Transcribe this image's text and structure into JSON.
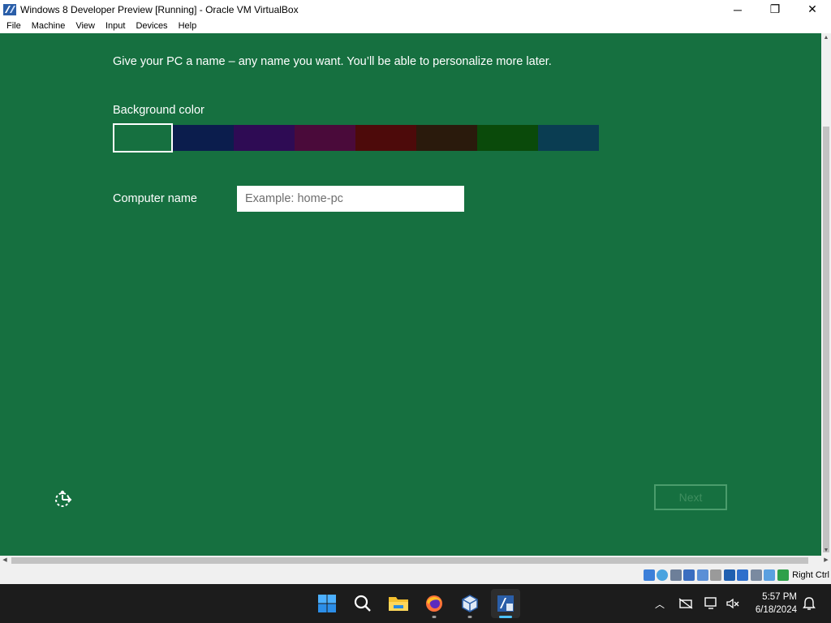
{
  "window": {
    "title": "Windows 8 Developer Preview [Running] - Oracle VM VirtualBox",
    "controls": {
      "minimize": "─",
      "restore": "❐",
      "close": "✕"
    }
  },
  "menu": [
    "File",
    "Machine",
    "View",
    "Input",
    "Devices",
    "Help"
  ],
  "setup": {
    "prompt": "Give your PC a name – any name you want. You’ll be able to personalize more later.",
    "background_label": "Background color",
    "swatches": [
      "#167040",
      "#0b1d4d",
      "#2e0b54",
      "#4a0a3a",
      "#4d0a0a",
      "#2a1a0c",
      "#0a4a0a",
      "#0a3d52"
    ],
    "selected_swatch": 0,
    "computer_name_label": "Computer name",
    "computer_name_value": "",
    "computer_name_placeholder": "Example: home-pc",
    "next_label": "Next"
  },
  "status_bar": {
    "icons": [
      "optical-drive-icon",
      "audio-icon",
      "usb-icon",
      "network-icon",
      "shared-folder-icon",
      "display-icon",
      "recording-icon",
      "cpu-icon",
      "mouse-integration-icon",
      "keyboard-capture-icon"
    ],
    "host_key": "Right Ctrl"
  },
  "taskbar": {
    "apps": [
      "windows-start-icon",
      "search-icon",
      "file-explorer-icon",
      "firefox-icon",
      "virtualbox-manager-icon",
      "virtualbox-vm-icon"
    ],
    "time": "5:57 PM",
    "date": "6/18/2024"
  }
}
